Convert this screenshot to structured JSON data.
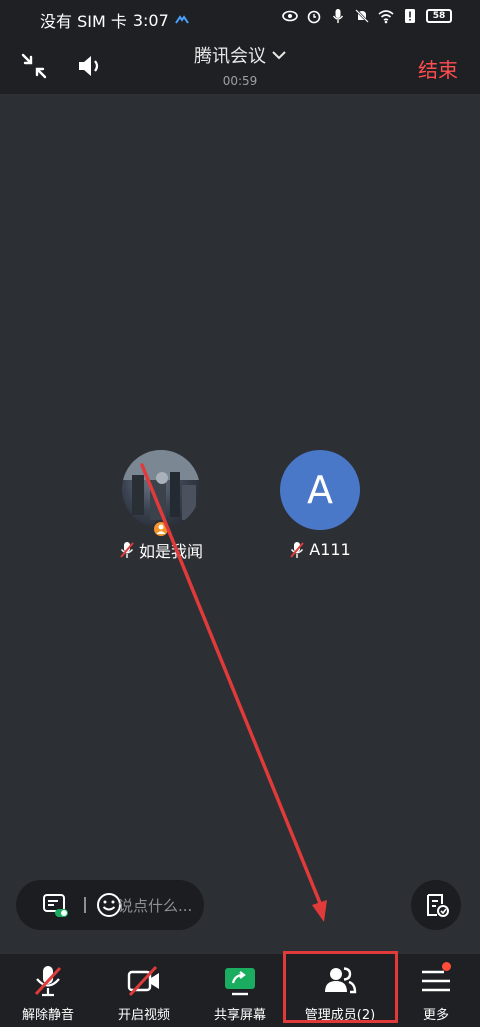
{
  "status_bar": {
    "carrier": "没有 SIM 卡",
    "time": "3:07",
    "battery": "58"
  },
  "header": {
    "title": "腾讯会议",
    "duration": "00:59",
    "end_label": "结束"
  },
  "participants": [
    {
      "name": "如是我闻",
      "avatar_type": "photo",
      "muted": true,
      "is_host": true
    },
    {
      "name": "A111",
      "avatar_letter": "A",
      "muted": true,
      "is_host": false
    }
  ],
  "chat": {
    "placeholder": "说点什么..."
  },
  "toolbar": {
    "items": [
      {
        "label": "解除静音",
        "icon": "mic-muted-icon"
      },
      {
        "label": "开启视频",
        "icon": "video-off-icon"
      },
      {
        "label": "共享屏幕",
        "icon": "share-screen-icon"
      },
      {
        "label": "管理成员(2)",
        "icon": "members-icon"
      },
      {
        "label": "更多",
        "icon": "more-menu-icon"
      }
    ]
  },
  "colors": {
    "accent_end": "#ff4d4f",
    "avatar_blue": "#4a78c8",
    "annotation_red": "#e03a3a",
    "share_green": "#1aad5f"
  }
}
